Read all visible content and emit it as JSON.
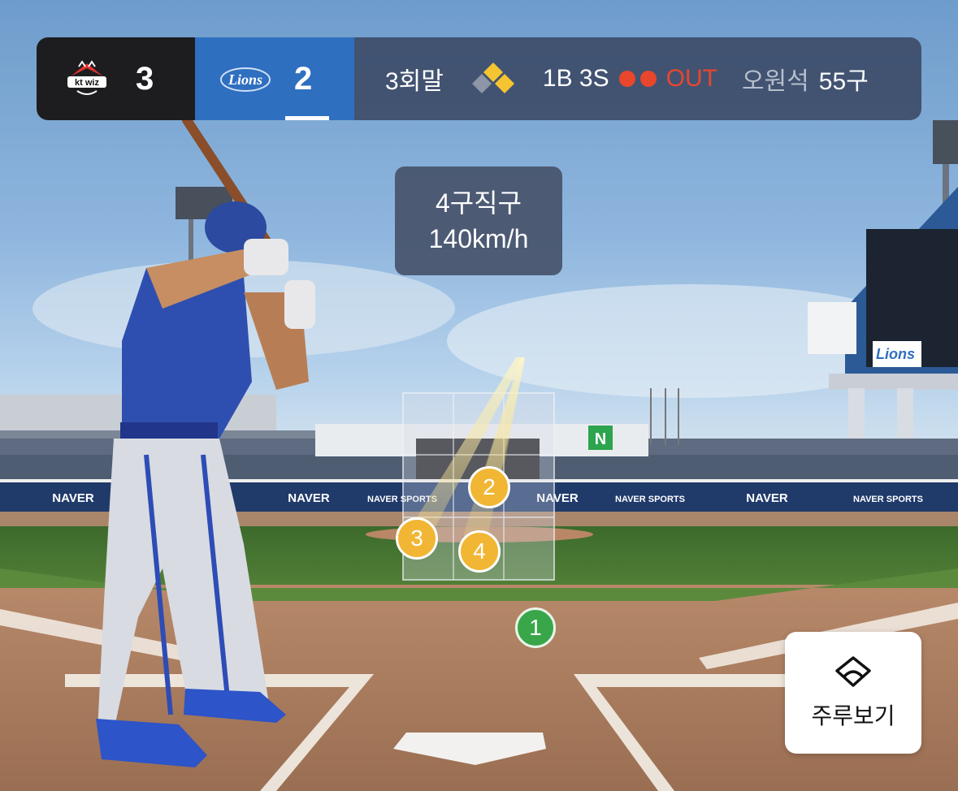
{
  "scoreboard": {
    "away": {
      "team": "kt wiz",
      "logo_text": "kt wiz",
      "score": "3"
    },
    "home": {
      "team": "Lions",
      "logo_text": "Lions",
      "score": "2"
    },
    "inning": "3회말",
    "count": "1B 3S",
    "outs": 2,
    "out_label": "OUT",
    "pitcher": "오원석",
    "pitch_count": "55구",
    "colors": {
      "away_bg": "#1d1d1f",
      "home_bg": "#2f6fc0",
      "out_red": "#e8462d",
      "base_yellow": "#f5c431"
    }
  },
  "pitch_info": {
    "pitch": "4구직구",
    "speed": "140km/h"
  },
  "pitches": [
    {
      "label": "1",
      "result": "ball",
      "color": "#3aa64a"
    },
    {
      "label": "2",
      "result": "strike",
      "color": "#f1b633"
    },
    {
      "label": "3",
      "result": "strike",
      "color": "#f1b633"
    },
    {
      "label": "4",
      "result": "strike",
      "color": "#f1b633"
    }
  ],
  "runner_button": {
    "label": "주루보기",
    "icon": "baseball-diamond-icon"
  },
  "stadium": {
    "ad_text": "NAVER",
    "ad_text_sports": "NAVER SPORTS",
    "scoreboard_logo": "Lions",
    "billboard_n": "N"
  }
}
